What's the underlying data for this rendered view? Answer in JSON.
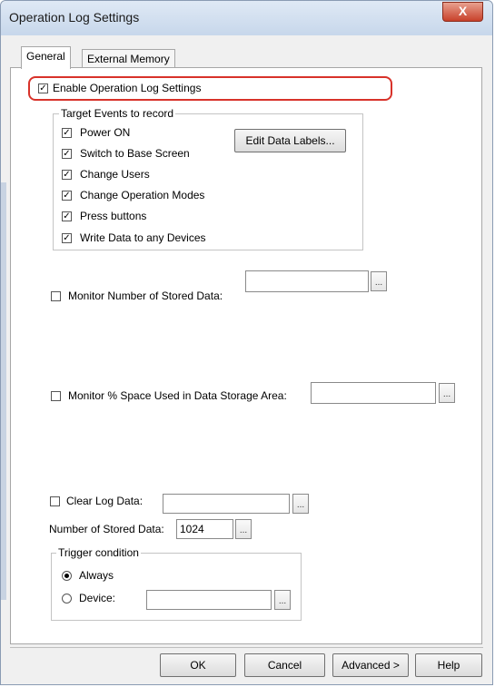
{
  "window": {
    "title": "Operation Log Settings",
    "close_glyph": "X"
  },
  "tabs": [
    {
      "label": "General"
    },
    {
      "label": "External Memory"
    }
  ],
  "enable": {
    "label": "Enable Operation Log Settings",
    "checked": true
  },
  "target_events": {
    "group_label": "Target Events to record",
    "items": [
      {
        "label": "Power ON",
        "checked": true
      },
      {
        "label": "Switch to Base Screen",
        "checked": true
      },
      {
        "label": "Change Users",
        "checked": true
      },
      {
        "label": "Change Operation Modes",
        "checked": true
      },
      {
        "label": "Press buttons",
        "checked": true
      },
      {
        "label": "Write Data to any Devices",
        "checked": true
      }
    ],
    "edit_button": "Edit Data Labels..."
  },
  "monitor_stored": {
    "label": "Monitor Number of Stored Data:",
    "value": "",
    "checked": false
  },
  "monitor_space": {
    "label": "Monitor % Space Used in Data Storage Area:",
    "value": "",
    "checked": false
  },
  "clear_log": {
    "label": "Clear Log Data:",
    "value": "",
    "checked": false
  },
  "stored_count": {
    "label": "Number of Stored Data:",
    "value": "1024"
  },
  "trigger": {
    "group_label": "Trigger condition",
    "always_label": "Always",
    "device_label": "Device:",
    "device_value": "",
    "selected": "Always"
  },
  "ellipsis": "...",
  "check_glyph": "✓",
  "footer": {
    "ok": "OK",
    "cancel": "Cancel",
    "advanced": "Advanced >",
    "help": "Help"
  }
}
